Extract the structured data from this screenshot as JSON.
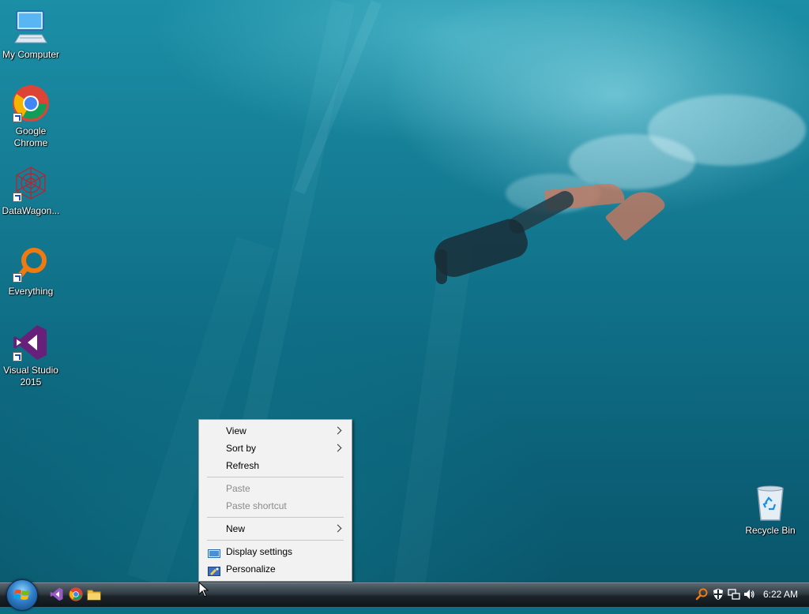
{
  "desktop": {
    "icons": [
      {
        "label": "My Computer",
        "icon": "computer-icon",
        "shortcut": false
      },
      {
        "label": "Google Chrome",
        "icon": "chrome-icon",
        "shortcut": true
      },
      {
        "label": "DataWagon...",
        "icon": "datawagon-icon",
        "shortcut": true
      },
      {
        "label": "Everything",
        "icon": "everything-search-icon",
        "shortcut": true
      },
      {
        "label": "Visual Studio 2015",
        "icon": "visual-studio-icon",
        "shortcut": true
      },
      {
        "label": "Recycle Bin",
        "icon": "recycle-bin-icon",
        "shortcut": false
      }
    ]
  },
  "context_menu": {
    "items": [
      {
        "label": "View",
        "submenu": true,
        "enabled": true
      },
      {
        "label": "Sort by",
        "submenu": true,
        "enabled": true
      },
      {
        "label": "Refresh",
        "submenu": false,
        "enabled": true
      },
      {
        "label": "Paste",
        "submenu": false,
        "enabled": false
      },
      {
        "label": "Paste shortcut",
        "submenu": false,
        "enabled": false
      },
      {
        "label": "New",
        "submenu": true,
        "enabled": true
      },
      {
        "label": "Display settings",
        "submenu": false,
        "enabled": true,
        "icon": "display-settings-icon"
      },
      {
        "label": "Personalize",
        "submenu": false,
        "enabled": true,
        "icon": "personalize-icon"
      }
    ]
  },
  "taskbar": {
    "start_icon": "windows-start-orb-icon",
    "pinned": [
      "visual-studio-icon",
      "chrome-icon",
      "file-explorer-icon"
    ],
    "tray": [
      "everything-search-icon",
      "security-shield-icon",
      "network-icon",
      "volume-icon"
    ],
    "clock": "6:22 AM"
  },
  "colors": {
    "menu_bg": "#f2f2f2",
    "menu_disabled_text": "#8a8a8a",
    "taskbar_dark": "#1c2429",
    "water": "#0f6f86"
  }
}
